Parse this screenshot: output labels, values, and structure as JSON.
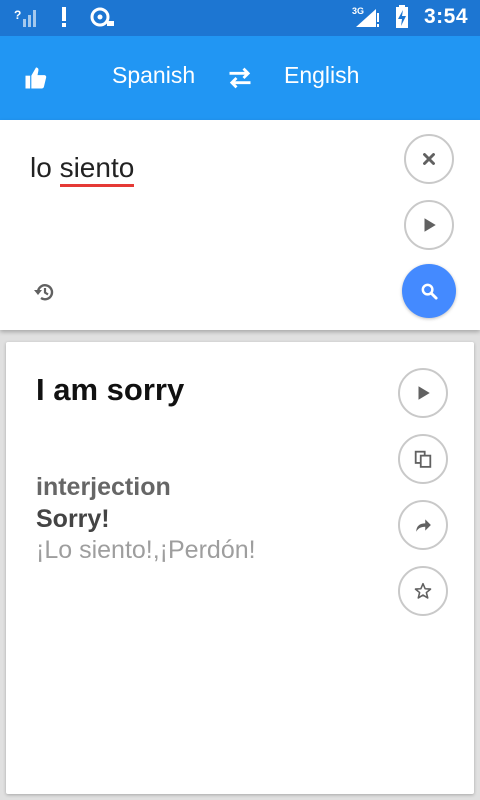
{
  "status_bar": {
    "time": "3:54",
    "network_label": "3G",
    "icons": [
      "signal-unknown-icon",
      "alert-icon",
      "sd-card-icon",
      "mobile-signal-icon",
      "battery-charging-icon"
    ]
  },
  "toolbar": {
    "like_icon": "thumbs-up-icon",
    "source_language": "Spanish",
    "swap_icon": "swap-arrows-icon",
    "target_language": "English"
  },
  "input": {
    "text_plain": "lo ",
    "text_misspelled": "siento",
    "clear_icon": "close-icon",
    "play_icon": "play-icon",
    "history_icon": "history-icon",
    "search_icon": "search-icon"
  },
  "result": {
    "translation": "I am sorry",
    "part_of_speech": "interjection",
    "meaning": "Sorry!",
    "examples": "¡Lo siento!,¡Perdón!",
    "actions": [
      "play-icon",
      "copy-icon",
      "share-icon",
      "star-icon"
    ]
  },
  "colors": {
    "status_bar": "#1d76d2",
    "app_bar": "#2196f3",
    "search_button": "#448aff",
    "spell_error": "#e53935"
  }
}
